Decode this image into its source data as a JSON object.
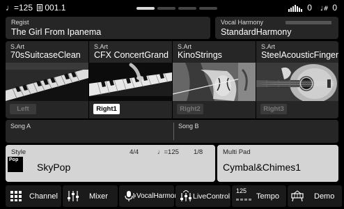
{
  "status": {
    "tempo": "♩=125",
    "song_number": "001.1",
    "left_meter_value": "0",
    "right_meter_value": "0"
  },
  "regist": {
    "label": "Regist",
    "value": "The Girl From Ipanema"
  },
  "vocal": {
    "label": "Vocal Harmony",
    "value": "StandardHarmony"
  },
  "parts": [
    {
      "label": "S.Art",
      "name": "70sSuitcaseClean",
      "button": "Left"
    },
    {
      "label": "S.Art",
      "name": "CFX ConcertGrand",
      "button": "Right1"
    },
    {
      "label": "S.Art",
      "name": "KinoStrings",
      "button": "Right2"
    },
    {
      "label": "S.Art",
      "name": "SteelAcousticFinger",
      "button": "Right3"
    }
  ],
  "songs": {
    "a_label": "Song A",
    "b_label": "Song B"
  },
  "style": {
    "label": "Style",
    "name": "SkyPop",
    "time_signature": "4/4",
    "tempo": "♩=125",
    "measure": "1/8",
    "icon_text": "Pop"
  },
  "multipad": {
    "label": "Multi Pad",
    "value": "Cymbal&Chimes1"
  },
  "bottom": {
    "channel": "Channel",
    "mixer": "Mixer",
    "vocalharmony": "VocalHarmony",
    "livecontrol": "LiveControl",
    "tempo_value": "125",
    "tempo": "Tempo",
    "demo": "Demo"
  }
}
